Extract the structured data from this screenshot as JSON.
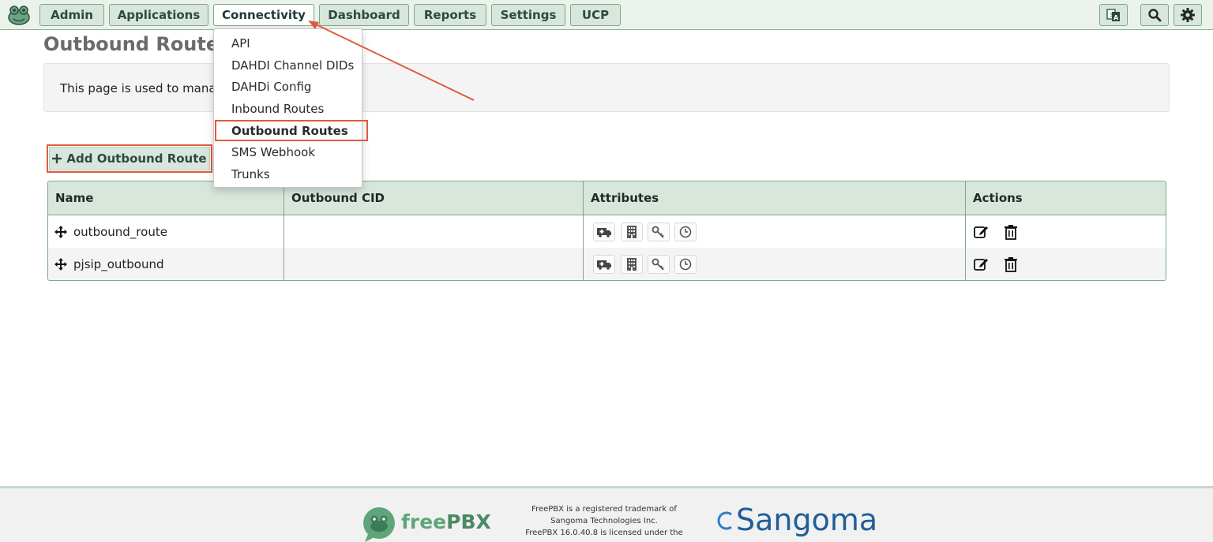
{
  "nav": {
    "items": [
      {
        "label": "Admin"
      },
      {
        "label": "Applications"
      },
      {
        "label": "Connectivity"
      },
      {
        "label": "Dashboard"
      },
      {
        "label": "Reports"
      },
      {
        "label": "Settings"
      },
      {
        "label": "UCP"
      }
    ],
    "active": "Connectivity",
    "right_icons": [
      "translate-icon",
      "search-icon",
      "gear-icon"
    ]
  },
  "dropdown": {
    "items": [
      "API",
      "DAHDI Channel DIDs",
      "DAHDi Config",
      "Inbound Routes",
      "Outbound Routes",
      "SMS Webhook",
      "Trunks"
    ],
    "highlighted": "Outbound Routes"
  },
  "page": {
    "title": "Outbound Routes",
    "info_text": "This page is used to manage",
    "add_button": "Add Outbound Route"
  },
  "table": {
    "headers": [
      "Name",
      "Outbound CID",
      "Attributes",
      "Actions"
    ],
    "rows": [
      {
        "name": "outbound_route",
        "cid": ""
      },
      {
        "name": "pjsip_outbound",
        "cid": ""
      }
    ],
    "attribute_icons": [
      "ambulance-icon",
      "building-icon",
      "key-icon",
      "clock-icon"
    ],
    "action_icons": [
      "edit-icon",
      "trash-icon"
    ]
  },
  "footer": {
    "logo_text_a": "free",
    "logo_text_b": "PBX",
    "legal_line1": "FreePBX is a registered trademark of",
    "legal_line2": "Sangoma Technologies Inc.",
    "legal_line3": "FreePBX 16.0.40.8 is licensed under the",
    "brand": "Sangoma"
  },
  "colors": {
    "accent": "#d8e6dc",
    "border": "#7da78b",
    "highlight": "#e05a3a"
  }
}
